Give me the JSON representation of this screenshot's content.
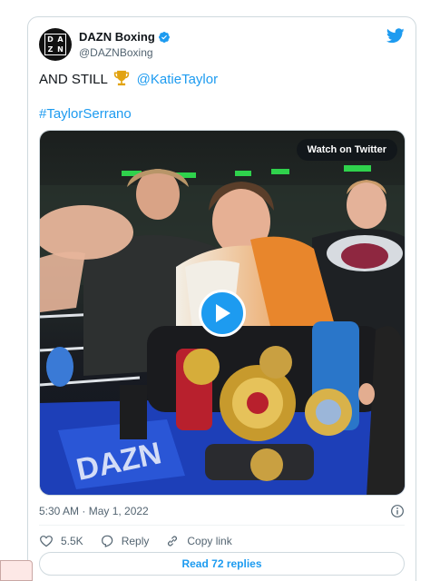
{
  "tweet": {
    "display_name": "DAZN Boxing",
    "handle": "@DAZNBoxing",
    "avatar_text": [
      "D",
      "A",
      "Z",
      "N"
    ],
    "text_prefix": "AND STILL",
    "mention": "@KatieTaylor",
    "hashtag": "#TaylorSerrano",
    "timestamp": "5:30 AM · May 1, 2022",
    "verified": true
  },
  "media": {
    "watch_label": "Watch on Twitter",
    "ring_logo_text": "DAZN"
  },
  "actions": {
    "likes": "5.5K",
    "reply_label": "Reply",
    "copy_link_label": "Copy link"
  },
  "footer": {
    "read_replies_label": "Read 72 replies"
  },
  "colors": {
    "accent": "#1d9bf0",
    "secondary_text": "#536471",
    "border": "#cfd9de"
  },
  "icons": [
    "verified-badge-icon",
    "twitter-bird-icon",
    "trophy-icon",
    "play-icon",
    "info-icon",
    "heart-icon",
    "reply-icon",
    "link-icon"
  ]
}
